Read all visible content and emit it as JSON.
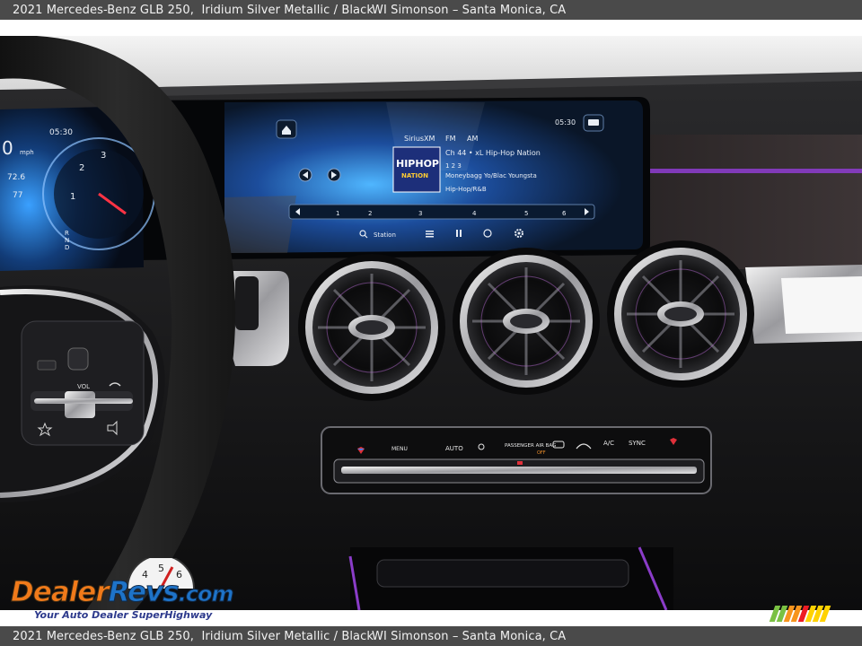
{
  "caption": {
    "vehicle": "2021 Mercedes-Benz GLB 250,  Iridium Silver Metallic / Black",
    "dealer": "WI Simonson – Santa Monica, CA"
  },
  "infotainment": {
    "clock": "05:30",
    "source": "SiriusXM",
    "band": "FM",
    "band_alt": "AM",
    "channel": "Ch 44 • xL Hip-Hop Nation",
    "preset_row": "1 2 3",
    "artist_track": "Moneybagg Yo/Blac Youngsta",
    "genre": "Hip-Hop/R&B",
    "logo_line1": "HIPHOP",
    "logo_line2": "NATION",
    "station_label": "Station",
    "presets": [
      "1",
      "2",
      "3",
      "4",
      "5",
      "6"
    ]
  },
  "cluster": {
    "clock": "05:30",
    "speed": "0",
    "speed_unit": "mph",
    "readout1": "72.6",
    "readout2": "77",
    "gear_marks": [
      "R",
      "N",
      "D"
    ],
    "dial_numbers": [
      "2",
      "1",
      "3"
    ]
  },
  "climate": {
    "labels": [
      "MENU",
      "AUTO",
      "PASSENGER AIR BAG",
      "OFF",
      "A/C",
      "SYNC"
    ]
  },
  "steering": {
    "vol_label": "VOL"
  },
  "watermark": {
    "brand_a": "Dealer",
    "brand_b": "Revs",
    "brand_c": ".com",
    "tagline": "Your Auto Dealer SuperHighway",
    "gauge_digits": [
      "4",
      "5",
      "6"
    ]
  },
  "colors": {
    "caption_bg": "#4a4a4a",
    "ambient_purple": "#8a3cc8",
    "screen_blue": "#2e8bff",
    "brand_orange": "#f07a1a",
    "brand_blue": "#1e73c8"
  }
}
